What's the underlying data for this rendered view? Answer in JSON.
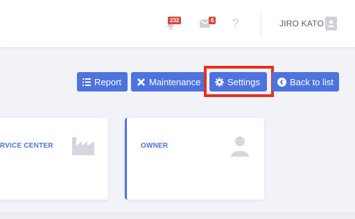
{
  "header": {
    "notifications": {
      "icon": "bell-icon",
      "count": "232"
    },
    "messages": {
      "icon": "envelope-icon",
      "count": "6"
    },
    "help": {
      "label": "?"
    },
    "user": {
      "name": "JIRO KATO",
      "icon": "user-badge-icon"
    }
  },
  "actions": {
    "report": {
      "label": "Report",
      "icon": "list-icon"
    },
    "maintenance": {
      "label": "Maintenance",
      "icon": "tools-icon"
    },
    "settings": {
      "label": "Settings",
      "icon": "gear-icon"
    },
    "back": {
      "label": "Back to list",
      "icon": "arrow-left-circle-icon"
    }
  },
  "cards": [
    {
      "title": "RVICE CENTER",
      "icon": "factory-icon"
    },
    {
      "title": "OWNER",
      "icon": "user-icon"
    }
  ],
  "colors": {
    "primary": "#4e73df",
    "highlight": "#e5301d",
    "badge": "#d9453a",
    "background": "#f2f3f8"
  }
}
